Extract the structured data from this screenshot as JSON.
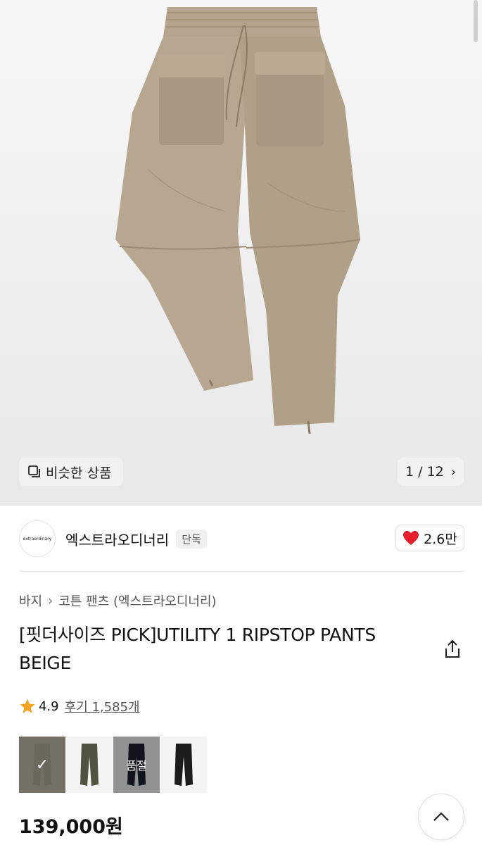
{
  "gallery": {
    "similar_label": "비슷한 상품",
    "pager": "1 / 12",
    "icons": [
      "similar-icon",
      "chevron-right-icon"
    ]
  },
  "brand": {
    "logo_text": "extraordinary",
    "name": "엑스트라오디너리",
    "badge": "단독",
    "likes": "2.6만",
    "heart_color": "#e8202e"
  },
  "breadcrumb": {
    "items": [
      "바지",
      "코튼 팬츠 (엑스트라오디너리)"
    ]
  },
  "product": {
    "title": "[핏더사이즈 PICK]UTILITY 1 RIPSTOP PANTS BEIGE",
    "rating": "4.9",
    "reviews": "후기 1,585개",
    "price": "139,000원",
    "star_color": "#f5a623"
  },
  "swatches": [
    {
      "name": "beige",
      "color": "#8f8a7d",
      "state": "selected",
      "label": "✓"
    },
    {
      "name": "khaki",
      "color": "#4f5440",
      "state": "normal",
      "label": ""
    },
    {
      "name": "navy",
      "color": "#1d2230",
      "state": "soldout",
      "label": "품절"
    },
    {
      "name": "black",
      "color": "#1b1b1b",
      "state": "normal",
      "label": ""
    }
  ]
}
